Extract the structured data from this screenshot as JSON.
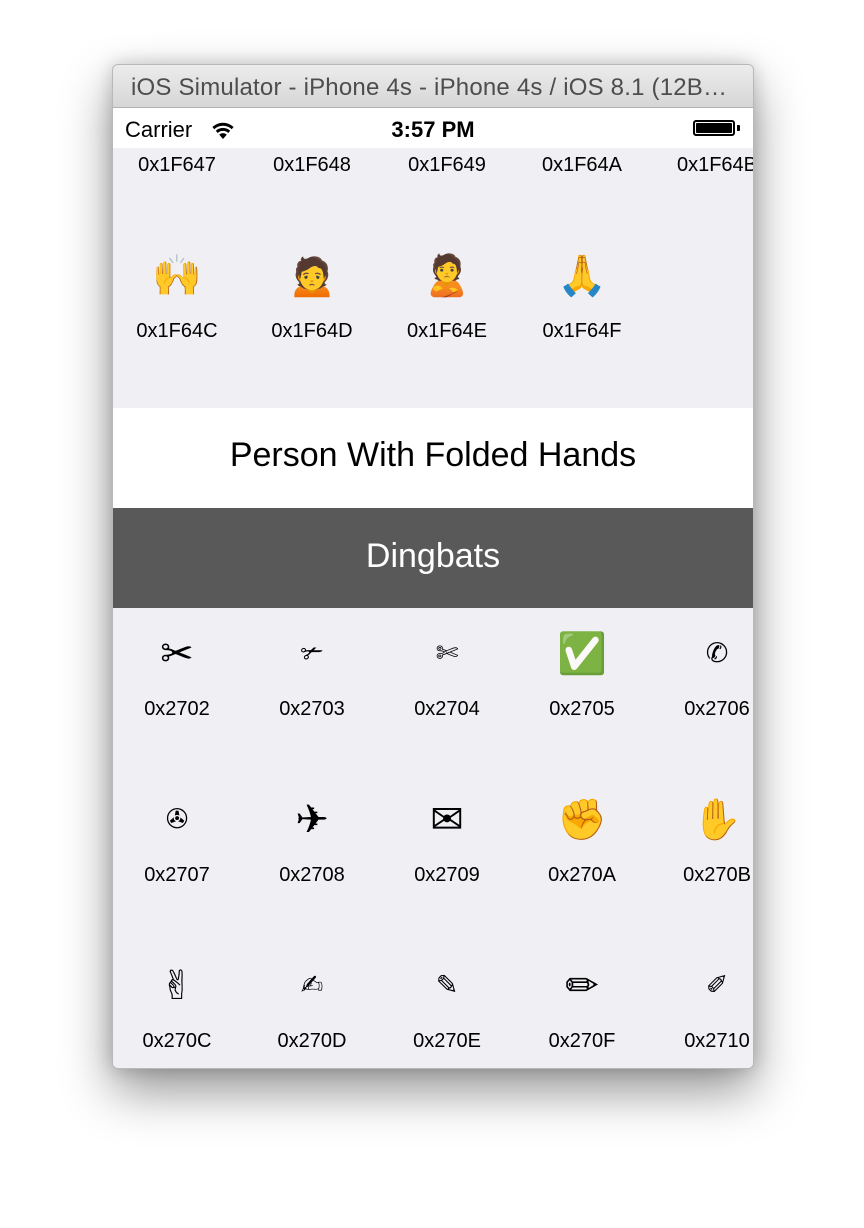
{
  "window": {
    "title": "iOS Simulator - iPhone 4s - iPhone 4s / iOS 8.1 (12B411)"
  },
  "status_bar": {
    "carrier": "Carrier",
    "wifi_icon": "wifi-icon",
    "time": "3:57 PM",
    "battery_icon": "battery-icon",
    "battery_level": 1.0
  },
  "top_grid": {
    "items": [
      {
        "glyph": "🙇",
        "code": "0x1F647",
        "style": "emoji"
      },
      {
        "glyph": "🙈",
        "code": "0x1F648",
        "style": "emoji"
      },
      {
        "glyph": "🙉",
        "code": "0x1F649",
        "style": "emoji"
      },
      {
        "glyph": "🙊",
        "code": "0x1F64A",
        "style": "emoji"
      },
      {
        "glyph": "🙋",
        "code": "0x1F64B",
        "style": "emoji"
      },
      {
        "glyph": "🙌",
        "code": "0x1F64C",
        "style": "emoji"
      },
      {
        "glyph": "🙍",
        "code": "0x1F64D",
        "style": "emoji"
      },
      {
        "glyph": "🙎",
        "code": "0x1F64E",
        "style": "emoji"
      },
      {
        "glyph": "🙏",
        "code": "0x1F64F",
        "style": "emoji"
      }
    ]
  },
  "selected_character": {
    "name": "Person With Folded Hands"
  },
  "section": {
    "title": "Dingbats"
  },
  "dingbats_grid": {
    "items": [
      {
        "glyph": "✂",
        "code": "0x2702",
        "style": "emoji"
      },
      {
        "glyph": "✃",
        "code": "0x2703",
        "style": "symbol"
      },
      {
        "glyph": "✄",
        "code": "0x2704",
        "style": "symbol"
      },
      {
        "glyph": "✅",
        "code": "0x2705",
        "style": "emoji"
      },
      {
        "glyph": "✆",
        "code": "0x2706",
        "style": "symbol"
      },
      {
        "glyph": "✇",
        "code": "0x2707",
        "style": "symbol"
      },
      {
        "glyph": "✈",
        "code": "0x2708",
        "style": "emoji"
      },
      {
        "glyph": "✉",
        "code": "0x2709",
        "style": "emoji"
      },
      {
        "glyph": "✊",
        "code": "0x270A",
        "style": "emoji"
      },
      {
        "glyph": "✋",
        "code": "0x270B",
        "style": "emoji"
      },
      {
        "glyph": "✌",
        "code": "0x270C",
        "style": "emoji"
      },
      {
        "glyph": "✍",
        "code": "0x270D",
        "style": "symbol"
      },
      {
        "glyph": "✎",
        "code": "0x270E",
        "style": "symbol"
      },
      {
        "glyph": "✏",
        "code": "0x270F",
        "style": "emoji"
      },
      {
        "glyph": "✐",
        "code": "0x2710",
        "style": "symbol"
      }
    ]
  }
}
